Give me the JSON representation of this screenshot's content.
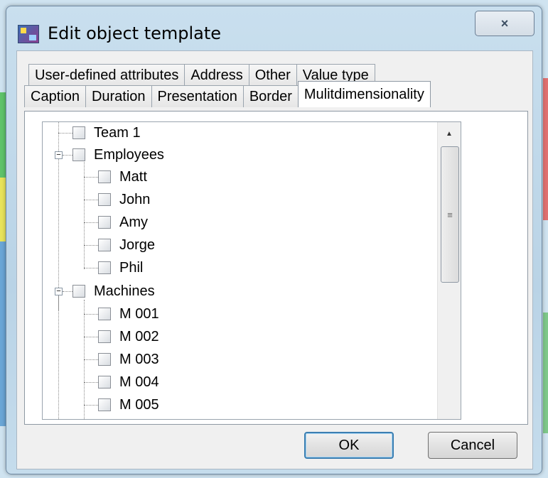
{
  "window": {
    "title": "Edit object template",
    "close_icon": "×"
  },
  "tabs_back_row": [
    {
      "label": "User-defined attributes"
    },
    {
      "label": "Address"
    },
    {
      "label": "Other"
    },
    {
      "label": "Value type"
    }
  ],
  "tabs_front_row": [
    {
      "label": "Caption"
    },
    {
      "label": "Duration"
    },
    {
      "label": "Presentation"
    },
    {
      "label": "Border"
    },
    {
      "label": "Mulitdimensionality",
      "active": true
    }
  ],
  "tree": {
    "items": [
      {
        "label": "Team 1",
        "checked": false
      },
      {
        "label": "Employees",
        "checked": false,
        "expanded": true
      },
      {
        "label": "Matt",
        "checked": false
      },
      {
        "label": "John",
        "checked": false
      },
      {
        "label": "Amy",
        "checked": false
      },
      {
        "label": "Jorge",
        "checked": false
      },
      {
        "label": "Phil",
        "checked": false
      },
      {
        "label": "Machines",
        "checked": false,
        "expanded": true
      },
      {
        "label": "M 001",
        "checked": false
      },
      {
        "label": "M 002",
        "checked": false
      },
      {
        "label": "M 003",
        "checked": false
      },
      {
        "label": "M 004",
        "checked": false
      },
      {
        "label": "M 005",
        "checked": false
      }
    ],
    "collapse_icon": "−",
    "scroll_up_icon": "▲",
    "scroll_grip_icon": "≡"
  },
  "buttons": {
    "ok_label": "OK",
    "cancel_label": "Cancel"
  },
  "colors": {
    "window_frame": "#b9d3e6",
    "default_button_border": "#3c7fb1"
  }
}
